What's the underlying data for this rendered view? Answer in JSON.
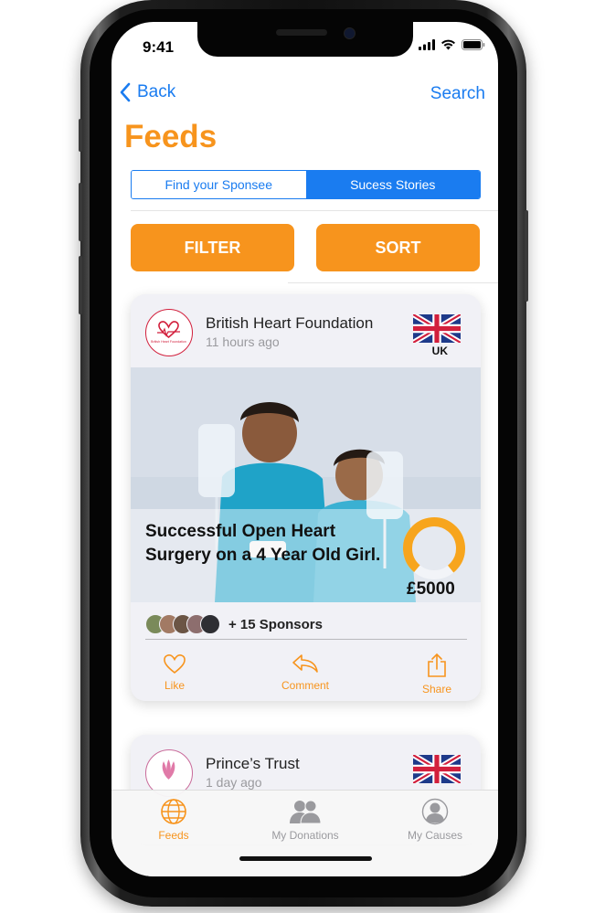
{
  "status": {
    "time": "9:41"
  },
  "nav": {
    "back_label": "Back",
    "search_label": "Search"
  },
  "page": {
    "title": "Feeds"
  },
  "segments": [
    {
      "label": "Find your Sponsee",
      "active": false
    },
    {
      "label": "Sucess Stories",
      "active": true
    }
  ],
  "buttons": {
    "filter": "FILTER",
    "sort": "SORT"
  },
  "posts": [
    {
      "org": "British Heart Foundation",
      "logo_text": "British Heart Foundation",
      "time": "11 hours ago",
      "country": "UK",
      "story_title": "Successful Open Heart Surgery on a 4 Year Old Girl.",
      "goal_amount": "£5000",
      "goal_progress": 0.78,
      "sponsors_text": "+ 15 Sponsors",
      "actions": {
        "like": "Like",
        "comment": "Comment",
        "share": "Share"
      }
    },
    {
      "org": "Prince’s Trust",
      "time": "1 day ago",
      "country": "UK"
    }
  ],
  "tabs": [
    {
      "label": "Feeds",
      "icon": "globe-icon",
      "active": true
    },
    {
      "label": "My Donations",
      "icon": "people-icon",
      "active": false
    },
    {
      "label": "My Causes",
      "icon": "person-icon",
      "active": false
    }
  ],
  "colors": {
    "accent": "#f7941d",
    "link": "#1a7cf0",
    "brand_red": "#d21f3c"
  }
}
